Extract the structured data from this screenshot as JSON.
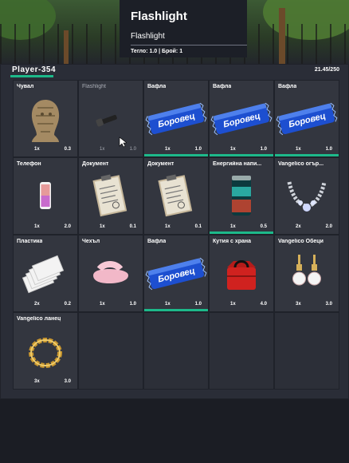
{
  "tooltip": {
    "title": "Flashlight",
    "subtitle": "Flashlight",
    "meta": "Тегло: 1.0 | Брой: 1"
  },
  "inventory": {
    "player": "Player-354",
    "weight": "21.45/250",
    "accent": "#1db98a",
    "slots": [
      {
        "name": "Чувал",
        "qty": "1x",
        "weight": "0.3",
        "icon": "sack-mask-icon",
        "bar": false,
        "dim": false
      },
      {
        "name": "Flashlight",
        "qty": "1x",
        "weight": "1.0",
        "icon": "flashlight-icon",
        "bar": false,
        "dim": true
      },
      {
        "name": "Вафла",
        "qty": "1x",
        "weight": "1.0",
        "icon": "wafer-icon",
        "bar": true,
        "dim": false
      },
      {
        "name": "Вафла",
        "qty": "1x",
        "weight": "1.0",
        "icon": "wafer-icon",
        "bar": true,
        "dim": false
      },
      {
        "name": "Вафла",
        "qty": "1x",
        "weight": "1.0",
        "icon": "wafer-icon",
        "bar": true,
        "dim": false
      },
      {
        "name": "Телефон",
        "qty": "1x",
        "weight": "2.0",
        "icon": "phone-icon",
        "bar": false,
        "dim": false
      },
      {
        "name": "Документ",
        "qty": "1x",
        "weight": "0.1",
        "icon": "document-icon",
        "bar": false,
        "dim": false
      },
      {
        "name": "Документ",
        "qty": "1x",
        "weight": "0.1",
        "icon": "document-icon",
        "bar": false,
        "dim": false
      },
      {
        "name": "Енергийна напи...",
        "qty": "1x",
        "weight": "0.5",
        "icon": "energy-can-icon",
        "bar": true,
        "dim": false
      },
      {
        "name": "Vangelico огър...",
        "qty": "2x",
        "weight": "2.0",
        "icon": "necklace-icon",
        "bar": false,
        "dim": false
      },
      {
        "name": "Пластика",
        "qty": "2x",
        "weight": "0.2",
        "icon": "cards-icon",
        "bar": false,
        "dim": false
      },
      {
        "name": "Чехъл",
        "qty": "1x",
        "weight": "1.0",
        "icon": "slipper-icon",
        "bar": false,
        "dim": false
      },
      {
        "name": "Вафла",
        "qty": "1x",
        "weight": "1.0",
        "icon": "wafer-icon",
        "bar": true,
        "dim": false
      },
      {
        "name": "Кутия с храна",
        "qty": "1x",
        "weight": "4.0",
        "icon": "food-bag-icon",
        "bar": false,
        "dim": false
      },
      {
        "name": "Vangelico Обеци",
        "qty": "3x",
        "weight": "3.0",
        "icon": "earrings-icon",
        "bar": false,
        "dim": false
      },
      {
        "name": "Vangelico ланец",
        "qty": "3x",
        "weight": "3.0",
        "icon": "gold-chain-icon",
        "bar": false,
        "dim": false
      }
    ],
    "wafer_label": "Боровец"
  }
}
